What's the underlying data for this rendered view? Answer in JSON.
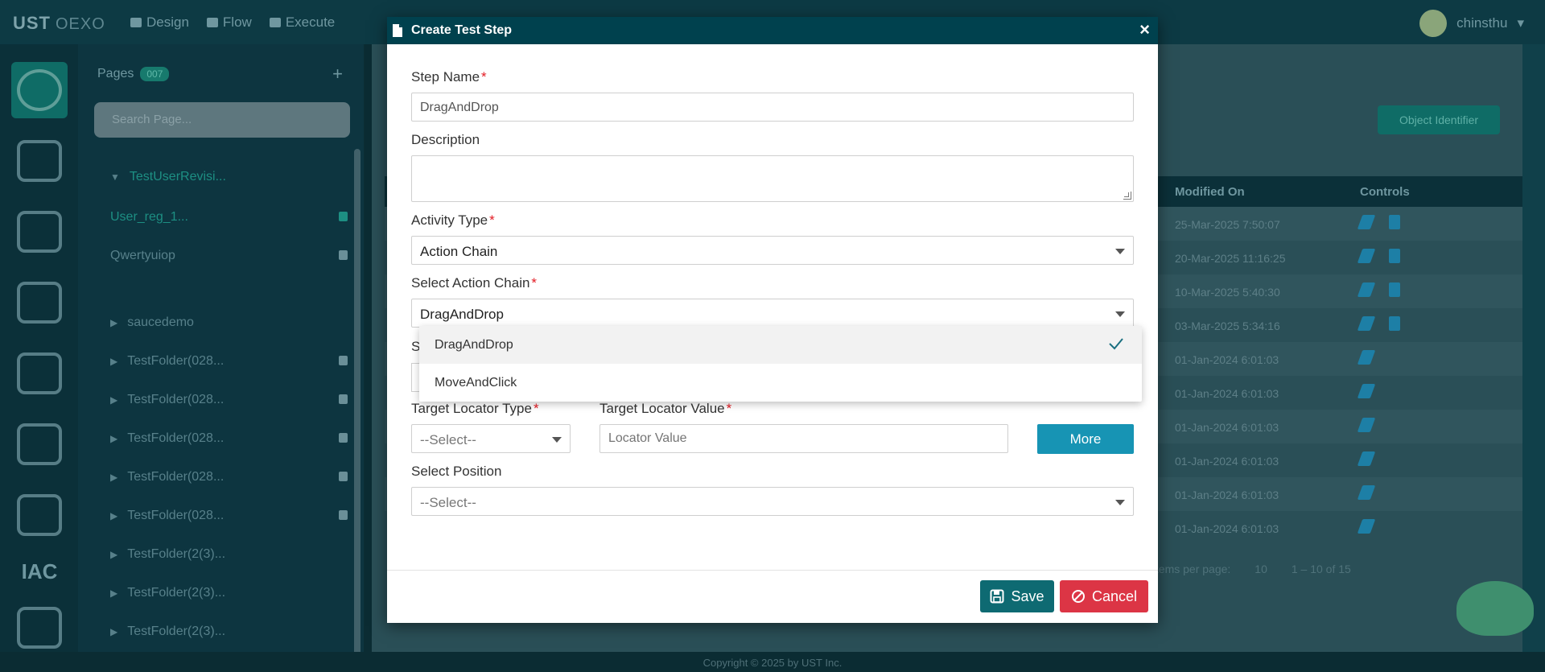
{
  "app": {
    "brand": "UST",
    "brand_suffix": "OEXO",
    "nav": [
      "Design",
      "Flow",
      "Execute"
    ],
    "user_name": "chinsthu"
  },
  "pages_panel": {
    "title": "Pages",
    "count": "007",
    "search_placeholder": "Search Page...",
    "items": [
      {
        "label": "TestUserRevisi...",
        "expanded": true
      },
      {
        "label": "User_reg_1...",
        "selected": true
      },
      {
        "label": "Qwertyuiop"
      },
      {
        "label": "saucedemo"
      },
      {
        "label": "TestFolder(028..."
      },
      {
        "label": "TestFolder(028..."
      },
      {
        "label": "TestFolder(028..."
      },
      {
        "label": "TestFolder(028..."
      },
      {
        "label": "TestFolder(028..."
      },
      {
        "label": "TestFolder(2(3)..."
      },
      {
        "label": "TestFolder(2(3)..."
      },
      {
        "label": "TestFolder(2(3)..."
      }
    ]
  },
  "background_table": {
    "object_identifier_button": "Object Identifier",
    "headers": {
      "modified_on": "Modified On",
      "controls": "Controls"
    },
    "rows": [
      {
        "modified": "25-Mar-2025 7:50:07",
        "delete": true
      },
      {
        "modified": "20-Mar-2025 11:16:25",
        "delete": true
      },
      {
        "modified": "10-Mar-2025 5:40:30",
        "delete": true
      },
      {
        "modified": "03-Mar-2025 5:34:16",
        "delete": true
      },
      {
        "modified": "01-Jan-2024 6:01:03",
        "delete": false
      },
      {
        "modified": "01-Jan-2024 6:01:03",
        "delete": false
      },
      {
        "modified": "01-Jan-2024 6:01:03",
        "delete": false
      },
      {
        "modified": "01-Jan-2024 6:01:03",
        "delete": false
      },
      {
        "modified": "01-Jan-2024 6:01:03",
        "delete": false
      },
      {
        "modified": "01-Jan-2024 6:01:03",
        "delete": false
      }
    ],
    "pager": {
      "items_per_page_label": "Items per page:",
      "page_size": "10",
      "range": "1 – 10 of 15"
    },
    "footer": "Copyright © 2025 by UST Inc."
  },
  "modal": {
    "title": "Create Test Step",
    "close": "×",
    "step_name": {
      "label": "Step Name",
      "value": "DragAndDrop"
    },
    "description": {
      "label": "Description",
      "value": ""
    },
    "activity_type": {
      "label": "Activity Type",
      "value": "Action Chain"
    },
    "action_chain": {
      "label": "Select Action Chain",
      "value": "DragAndDrop",
      "options": [
        {
          "label": "DragAndDrop",
          "selected": true
        },
        {
          "label": "MoveAndClick",
          "selected": false
        }
      ]
    },
    "hidden_label_initial": "S",
    "target_locator_type": {
      "label": "Target Locator Type",
      "value": "--Select--"
    },
    "target_locator_value": {
      "label": "Target Locator Value",
      "placeholder": "Locator Value"
    },
    "more_button": "More",
    "select_position": {
      "label": "Select Position",
      "value": "--Select--"
    },
    "save_button": "Save",
    "cancel_button": "Cancel",
    "required_mark": "*"
  },
  "colors": {
    "header": "#00414e",
    "save": "#0e6a72",
    "cancel": "#dc3545",
    "more": "#1794b4",
    "required": "#e31b23",
    "check": "#1a6f80"
  }
}
